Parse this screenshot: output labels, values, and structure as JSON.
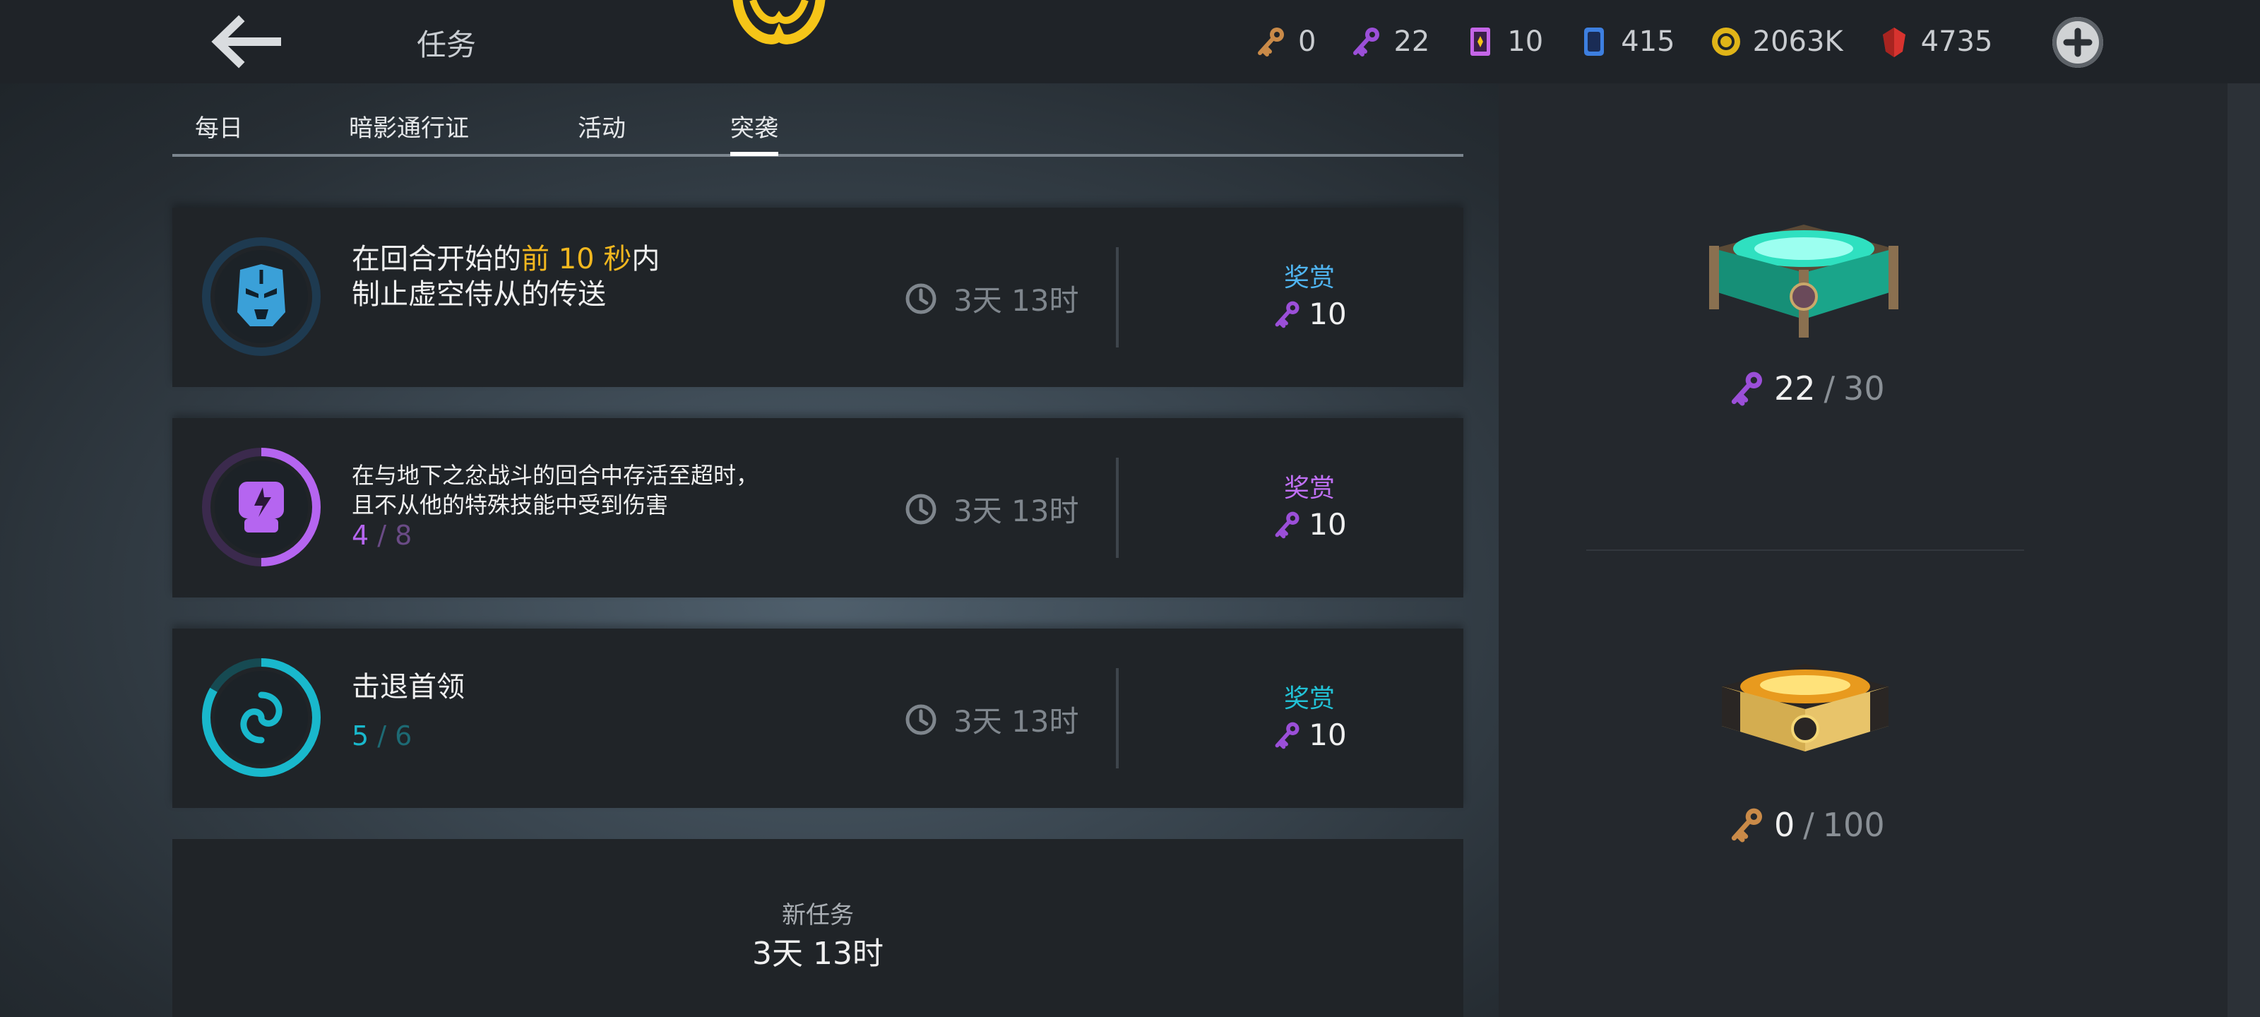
{
  "header": {
    "title": "任务",
    "currencies": [
      {
        "icon": "bronze-key-icon",
        "value": "0"
      },
      {
        "icon": "purple-key-icon",
        "value": "22"
      },
      {
        "icon": "ticket-icon",
        "value": "10"
      },
      {
        "icon": "card-icon",
        "value": "415"
      },
      {
        "icon": "gold-coin-icon",
        "value": "2063K"
      },
      {
        "icon": "red-gem-icon",
        "value": "4735"
      }
    ]
  },
  "tabs": [
    {
      "label": "每日",
      "active": false
    },
    {
      "label": "暗影通行证",
      "active": false
    },
    {
      "label": "活动",
      "active": false
    },
    {
      "label": "突袭",
      "active": true
    }
  ],
  "missions": [
    {
      "icon": "helmet-icon",
      "text_before": "在回合开始的",
      "text_highlight": "前 10 秒",
      "text_after": "内",
      "text_line2": "制止虚空侍从的传送",
      "progress_current": "",
      "progress_max": "",
      "timer": "3天 13时",
      "reward_label": "奖赏",
      "reward_amount": "10",
      "accent": "#3aa0d8"
    },
    {
      "icon": "fist-icon",
      "text_line1": "在与地下之忿战斗的回合中存活至超时，",
      "text_line2": "且不从他的特殊技能中受到伤害",
      "progress_current": "4",
      "progress_max": "8",
      "progress_fraction": 0.5,
      "timer": "3天 13时",
      "reward_label": "奖赏",
      "reward_amount": "10",
      "accent": "#b565f0"
    },
    {
      "icon": "vortex-icon",
      "text_line1": "击退首领",
      "progress_current": "5",
      "progress_max": "6",
      "progress_fraction": 0.8333,
      "timer": "3天 13时",
      "reward_label": "奖赏",
      "reward_amount": "10",
      "accent": "#19b8cc"
    }
  ],
  "new_task": {
    "label": "新任务",
    "timer": "3天 13时"
  },
  "chests": [
    {
      "icon": "purple-key-icon",
      "current": "22",
      "separator": "/",
      "max": "30",
      "fraction": 0.7333
    },
    {
      "icon": "bronze-key-icon",
      "current": "0",
      "separator": "/",
      "max": "100",
      "fraction": 0.0
    }
  ],
  "colors": {
    "highlight": "#f2b71f",
    "purple_key": "#9b4fd8",
    "bronze_key": "#c98a48"
  }
}
